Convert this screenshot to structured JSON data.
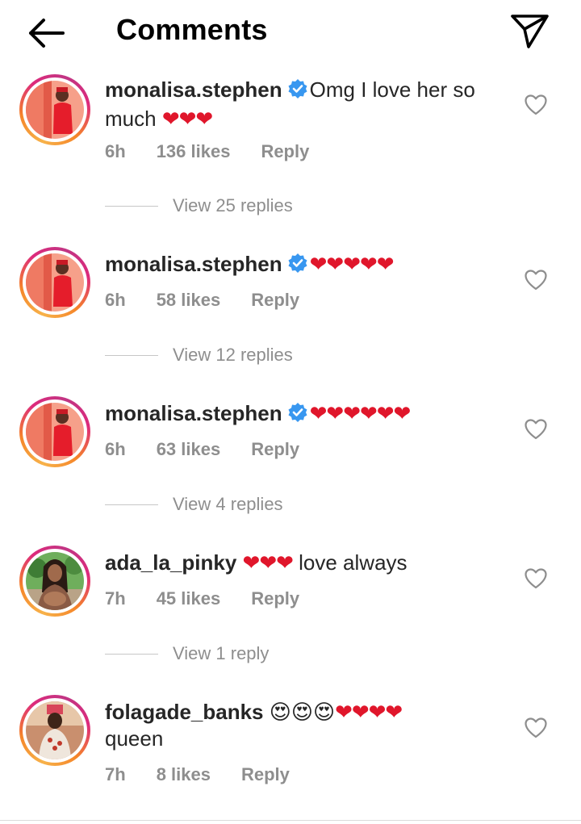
{
  "header": {
    "title": "Comments"
  },
  "comments": [
    {
      "username": "monalisa.stephen",
      "verified": true,
      "text": "Omg I love her so much",
      "hearts": "❤❤❤",
      "time": "6h",
      "likes": "136 likes",
      "reply": "Reply",
      "view_replies": "View 25 replies"
    },
    {
      "username": "monalisa.stephen",
      "verified": true,
      "text": "",
      "hearts": "❤❤❤❤❤",
      "time": "6h",
      "likes": "58 likes",
      "reply": "Reply",
      "view_replies": "View 12 replies"
    },
    {
      "username": "monalisa.stephen",
      "verified": true,
      "text": "",
      "hearts": "❤❤❤❤❤❤",
      "time": "6h",
      "likes": "63 likes",
      "reply": "Reply",
      "view_replies": "View 4 replies"
    },
    {
      "username": "ada_la_pinky",
      "verified": false,
      "text": "love always",
      "hearts": "❤❤❤",
      "time": "7h",
      "likes": "45 likes",
      "reply": "Reply",
      "view_replies": "View 1 reply"
    },
    {
      "username": "folagade_banks",
      "verified": false,
      "emojis": "😍😍😍",
      "hearts": "❤❤❤❤",
      "text": "queen",
      "time": "7h",
      "likes": "8 likes",
      "reply": "Reply"
    }
  ],
  "colors": {
    "heart": "#e0162b",
    "verified": "#3897f0",
    "meta": "#8e8e8e",
    "text": "#262626"
  },
  "icons": {
    "back": "back-arrow-icon",
    "share": "paper-plane-icon",
    "like": "heart-outline-icon",
    "verified": "verified-badge-icon"
  }
}
